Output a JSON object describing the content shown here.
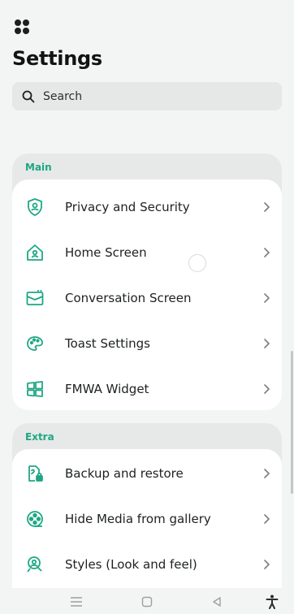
{
  "page": {
    "title": "Settings"
  },
  "search": {
    "placeholder": "Search"
  },
  "sections": [
    {
      "label": "Main",
      "items": [
        {
          "label": "Privacy and Security",
          "icon": "shield-lock-icon"
        },
        {
          "label": "Home Screen",
          "icon": "home-icon"
        },
        {
          "label": "Conversation Screen",
          "icon": "chat-window-icon"
        },
        {
          "label": "Toast Settings",
          "icon": "palette-icon"
        },
        {
          "label": "FMWA Widget",
          "icon": "widget-grid-icon"
        }
      ]
    },
    {
      "label": "Extra",
      "items": [
        {
          "label": "Backup and restore",
          "icon": "backup-icon"
        },
        {
          "label": "Hide Media from gallery",
          "icon": "film-reel-icon"
        },
        {
          "label": "Styles (Look and feel)",
          "icon": "brush-icon"
        }
      ]
    }
  ],
  "colors": {
    "accent": "#1ea784",
    "background": "#f3f5f4",
    "card": "#ffffff",
    "section": "#e6e9e8"
  }
}
